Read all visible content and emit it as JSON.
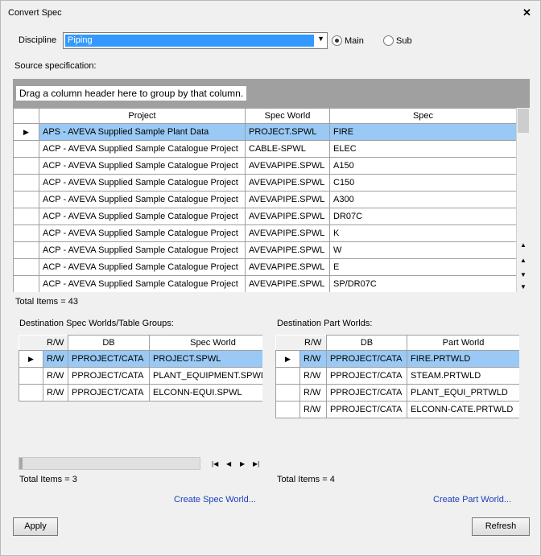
{
  "window": {
    "title": "Convert Spec"
  },
  "discipline": {
    "label": "Discipline",
    "value": "Piping",
    "main_label": "Main",
    "sub_label": "Sub"
  },
  "source": {
    "label": "Source specification:",
    "group_hint": "Drag a column header here to group by that column.",
    "columns": [
      "Project",
      "Spec World",
      "Spec"
    ],
    "rows": [
      [
        "APS - AVEVA Supplied Sample Plant Data",
        "PROJECT.SPWL",
        "FIRE"
      ],
      [
        "ACP - AVEVA Supplied Sample Catalogue Project",
        "CABLE-SPWL",
        "ELEC"
      ],
      [
        "ACP - AVEVA Supplied Sample Catalogue Project",
        "AVEVAPIPE.SPWL",
        "A150"
      ],
      [
        "ACP - AVEVA Supplied Sample Catalogue Project",
        "AVEVAPIPE.SPWL",
        "C150"
      ],
      [
        "ACP - AVEVA Supplied Sample Catalogue Project",
        "AVEVAPIPE.SPWL",
        "A300"
      ],
      [
        "ACP - AVEVA Supplied Sample Catalogue Project",
        "AVEVAPIPE.SPWL",
        "DR07C"
      ],
      [
        "ACP - AVEVA Supplied Sample Catalogue Project",
        "AVEVAPIPE.SPWL",
        "K"
      ],
      [
        "ACP - AVEVA Supplied Sample Catalogue Project",
        "AVEVAPIPE.SPWL",
        "W"
      ],
      [
        "ACP - AVEVA Supplied Sample Catalogue Project",
        "AVEVAPIPE.SPWL",
        "E"
      ],
      [
        "ACP - AVEVA Supplied Sample Catalogue Project",
        "AVEVAPIPE.SPWL",
        "SP/DR07C"
      ]
    ],
    "total": "Total Items = 43"
  },
  "dest_spec": {
    "label": "Destination Spec Worlds/Table Groups:",
    "columns": [
      "R/W",
      "DB",
      "Spec World"
    ],
    "rows": [
      [
        "R/W",
        "PPROJECT/CATA",
        "PROJECT.SPWL"
      ],
      [
        "R/W",
        "PPROJECT/CATA",
        "PLANT_EQUIPMENT.SPWL"
      ],
      [
        "R/W",
        "PPROJECT/CATA",
        "ELCONN-EQUI.SPWL"
      ]
    ],
    "total": "Total Items = 3",
    "create_link": "Create Spec World..."
  },
  "dest_part": {
    "label": "Destination Part Worlds:",
    "columns": [
      "R/W",
      "DB",
      "Part World"
    ],
    "rows": [
      [
        "R/W",
        "PPROJECT/CATA",
        "FIRE.PRTWLD"
      ],
      [
        "R/W",
        "PPROJECT/CATA",
        "STEAM.PRTWLD"
      ],
      [
        "R/W",
        "PPROJECT/CATA",
        "PLANT_EQUI_PRTWLD"
      ],
      [
        "R/W",
        "PPROJECT/CATA",
        "ELCONN-CATE.PRTWLD"
      ]
    ],
    "total": "Total Items = 4",
    "create_link": "Create Part World..."
  },
  "buttons": {
    "apply": "Apply",
    "refresh": "Refresh"
  },
  "colors": {
    "selection": "#99c9f4",
    "highlight": "#3399ff",
    "link": "#1a3fbf"
  }
}
